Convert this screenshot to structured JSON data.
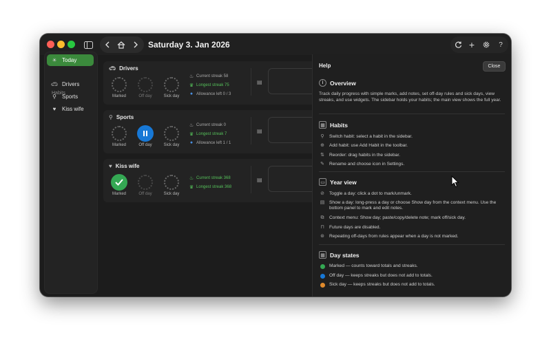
{
  "toolbar": {
    "date_title": "Saturday 3. Jan 2026"
  },
  "sidebar": {
    "items": [
      {
        "label": "Today",
        "icon": "sun-icon"
      }
    ],
    "section_label": "Habits",
    "habits": [
      {
        "label": "Drivers",
        "icon": "car-icon"
      },
      {
        "label": "Sports",
        "icon": "runner-icon"
      },
      {
        "label": "Kiss wife",
        "icon": "heart-icon"
      }
    ]
  },
  "habits": [
    {
      "name": "Drivers",
      "labels": [
        "Marked",
        "Off day",
        "Sick day"
      ],
      "state": "none",
      "stats": [
        "Current streak 58",
        "Longest streak 75",
        "Allowance left 0 / 3"
      ]
    },
    {
      "name": "Sports",
      "labels": [
        "Marked",
        "Off day",
        "Sick day"
      ],
      "state": "off",
      "stats": [
        "Current streak 0",
        "Longest streak 7",
        "Allowance left 1 / 1"
      ]
    },
    {
      "name": "Kiss wife",
      "labels": [
        "Marked",
        "Off day",
        "Sick day"
      ],
      "state": "marked",
      "stats": [
        "Current streak 368",
        "Longest streak 368"
      ]
    }
  ],
  "help": {
    "title": "Help",
    "close_label": "Close",
    "overview": {
      "title": "Overview",
      "text": "Track daily progress with simple marks, add notes, set off-day rules and sick days, view streaks, and use widgets. The sidebar holds your habits; the main view shows the full year."
    },
    "habits": {
      "title": "Habits",
      "rows": [
        "Switch habit: select a habit in the sidebar.",
        "Add habit: use Add Habit in the toolbar.",
        "Reorder: drag habits in the sidebar.",
        "Rename and choose icon in Settings."
      ]
    },
    "year_view": {
      "title": "Year view",
      "rows": [
        "Toggle a day: click a dot to mark/unmark.",
        "Show a day: long-press a day or choose Show day from the context menu. Use the bottom panel to mark and edit notes.",
        "Context menu: Show day; paste/copy/delete note; mark off/sick day.",
        "Future days are disabled.",
        "Repeating off-days from rules appear when a day is not marked."
      ]
    },
    "day_states": {
      "title": "Day states",
      "rows": [
        "Marked — counts toward totals and streaks.",
        "Off day — keeps streaks but does not add to totals.",
        "Sick day — keeps streaks but does not add to totals."
      ]
    }
  },
  "colors": {
    "accent_green": "#3b8a3c",
    "marked": "#34a853",
    "off_day": "#1778d6",
    "sick_day": "#e08a2c"
  }
}
